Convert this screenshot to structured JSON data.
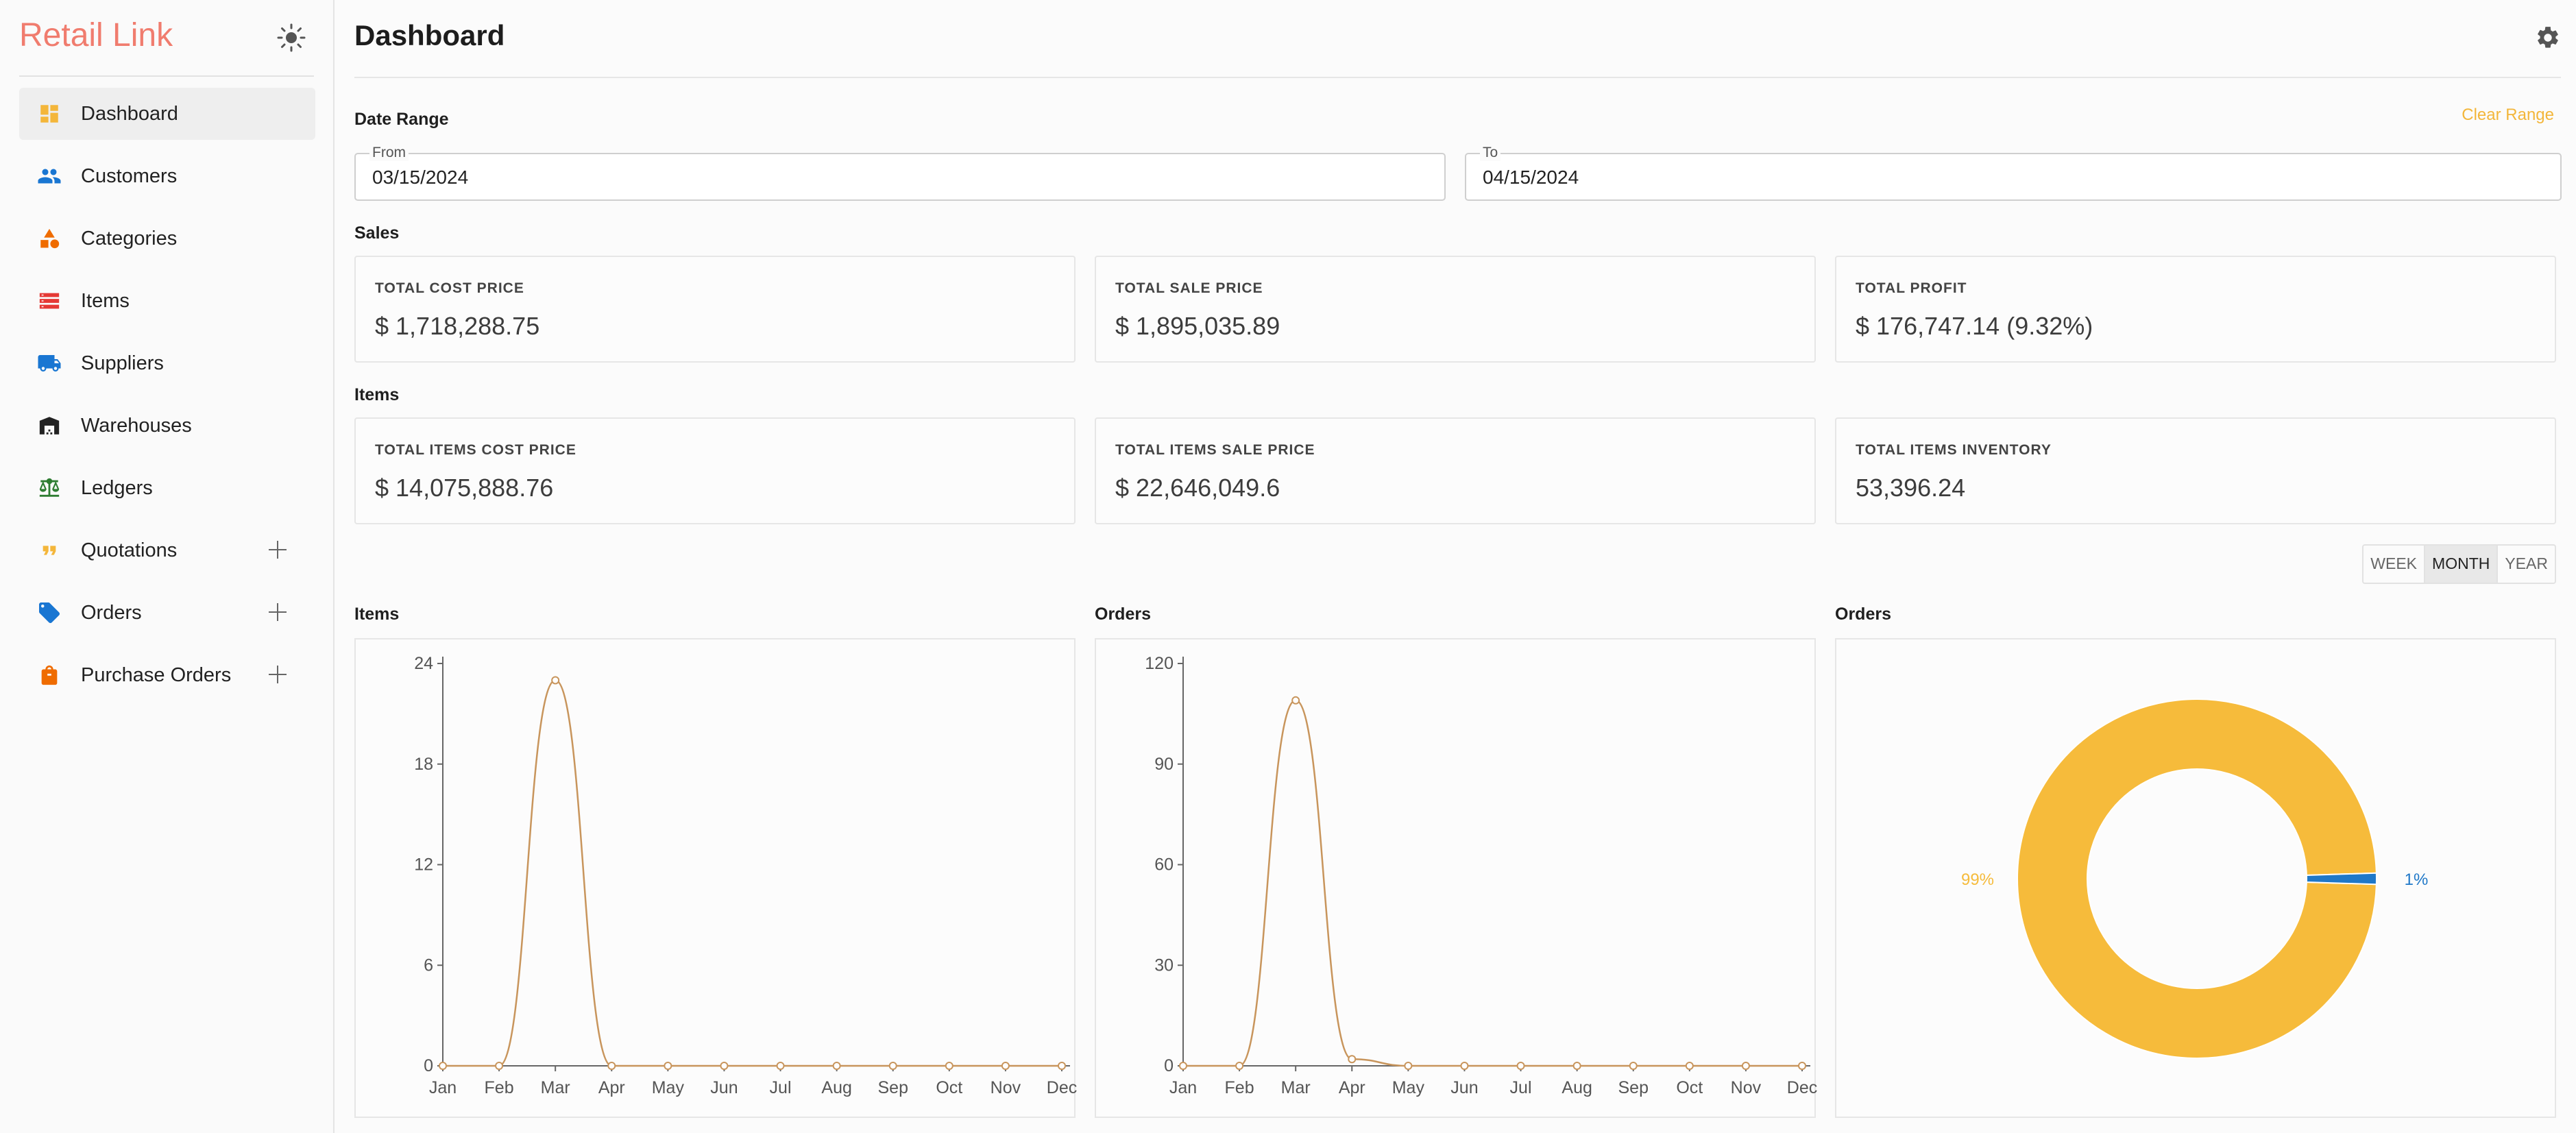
{
  "app": {
    "title": "Retail Link"
  },
  "sidebar": {
    "items": [
      {
        "label": "Dashboard",
        "icon": "dashboard-icon",
        "color": "#f4b63a",
        "active": true,
        "expandable": false
      },
      {
        "label": "Customers",
        "icon": "people-icon",
        "color": "#1976d2",
        "active": false,
        "expandable": false
      },
      {
        "label": "Categories",
        "icon": "category-icon",
        "color": "#ef6c00",
        "active": false,
        "expandable": false
      },
      {
        "label": "Items",
        "icon": "list-icon",
        "color": "#e53935",
        "active": false,
        "expandable": false
      },
      {
        "label": "Suppliers",
        "icon": "truck-icon",
        "color": "#1976d2",
        "active": false,
        "expandable": false
      },
      {
        "label": "Warehouses",
        "icon": "warehouse-icon",
        "color": "#222222",
        "active": false,
        "expandable": false
      },
      {
        "label": "Ledgers",
        "icon": "balance-icon",
        "color": "#2e7d32",
        "active": false,
        "expandable": false
      },
      {
        "label": "Quotations",
        "icon": "quote-icon",
        "color": "#f4b63a",
        "active": false,
        "expandable": true
      },
      {
        "label": "Orders",
        "icon": "tag-icon",
        "color": "#1976d2",
        "active": false,
        "expandable": true
      },
      {
        "label": "Purchase Orders",
        "icon": "bag-icon",
        "color": "#ef6c00",
        "active": false,
        "expandable": true
      }
    ]
  },
  "header": {
    "title": "Dashboard"
  },
  "date_range": {
    "label": "Date Range",
    "clear_label": "Clear Range",
    "from_label": "From",
    "from_value": "03/15/2024",
    "to_label": "To",
    "to_value": "04/15/2024"
  },
  "sales": {
    "label": "Sales",
    "cards": [
      {
        "caption": "TOTAL COST PRICE",
        "value": "$ 1,718,288.75"
      },
      {
        "caption": "TOTAL SALE PRICE",
        "value": "$ 1,895,035.89"
      },
      {
        "caption": "TOTAL PROFIT",
        "value": "$ 176,747.14 (9.32%)"
      }
    ]
  },
  "items": {
    "label": "Items",
    "cards": [
      {
        "caption": "TOTAL ITEMS COST PRICE",
        "value": "$ 14,075,888.76"
      },
      {
        "caption": "TOTAL ITEMS SALE PRICE",
        "value": "$ 22,646,049.6"
      },
      {
        "caption": "TOTAL ITEMS INVENTORY",
        "value": "53,396.24"
      }
    ]
  },
  "period_toggle": {
    "options": [
      "WEEK",
      "MONTH",
      "YEAR"
    ],
    "selected": "MONTH"
  },
  "colors": {
    "accent": "#f4b63a",
    "line": "#c8955c",
    "pie_primary": "#f6bb3b",
    "pie_secondary": "#1f78c8"
  },
  "chart_data": [
    {
      "type": "line",
      "title": "Items",
      "x": [
        "Jan",
        "Feb",
        "Mar",
        "Apr",
        "May",
        "Jun",
        "Jul",
        "Aug",
        "Sep",
        "Oct",
        "Nov",
        "Dec"
      ],
      "series": [
        {
          "values": [
            0,
            0,
            23,
            0,
            0,
            0,
            0,
            0,
            0,
            0,
            0,
            0
          ]
        }
      ],
      "ylim": [
        0,
        24
      ],
      "yticks": [
        0,
        6,
        12,
        18,
        24
      ]
    },
    {
      "type": "line",
      "title": "Orders",
      "x": [
        "Jan",
        "Feb",
        "Mar",
        "Apr",
        "May",
        "Jun",
        "Jul",
        "Aug",
        "Sep",
        "Oct",
        "Nov",
        "Dec"
      ],
      "series": [
        {
          "values": [
            0,
            0,
            109,
            2,
            0,
            0,
            0,
            0,
            0,
            0,
            0,
            0
          ]
        }
      ],
      "ylim": [
        0,
        120
      ],
      "yticks": [
        0,
        30,
        60,
        90,
        120
      ]
    },
    {
      "type": "pie",
      "title": "Orders",
      "slices": [
        {
          "label": "99%",
          "value": 99,
          "color": "#f6bb3b"
        },
        {
          "label": "1%",
          "value": 1,
          "color": "#1f78c8"
        }
      ]
    }
  ]
}
